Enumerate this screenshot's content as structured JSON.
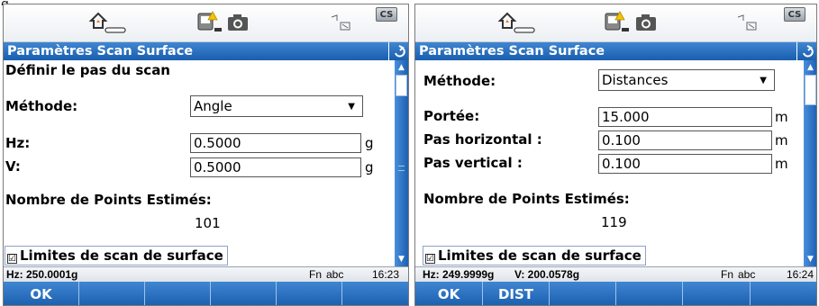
{
  "caption": "g",
  "left": {
    "title": "Paramètres Scan Surface",
    "section_heading": "Définir le pas du scan",
    "method_label": "Méthode:",
    "method_value": "Angle",
    "hz_label": "Hz:",
    "hz_value": "0.5000",
    "hz_unit": "g",
    "v_label": "V:",
    "v_value": "0.5000",
    "v_unit": "g",
    "estimate_label": "Nombre de Points Estimés:",
    "estimate_value": "101",
    "checkbox_label": "Limites de scan de surface",
    "status_hz": "Hz: 250.0001g",
    "status_fn": "Fn",
    "status_abc": "abc",
    "status_time": "16:23",
    "softkeys": [
      "OK",
      "",
      "",
      "",
      "",
      ""
    ]
  },
  "right": {
    "title": "Paramètres Scan Surface",
    "method_label": "Méthode:",
    "method_value": "Distances",
    "range_label": "Portée:",
    "range_value": "15.000",
    "range_unit": "m",
    "hstep_label": "Pas horizontal :",
    "hstep_value": "0.100",
    "hstep_unit": "m",
    "vstep_label": "Pas vertical :",
    "vstep_value": "0.100",
    "vstep_unit": "m",
    "estimate_label": "Nombre de Points Estimés:",
    "estimate_value": "119",
    "checkbox_label": "Limites de scan de surface",
    "status_hz": "Hz: 249.9999g",
    "status_v": "V: 200.0578g",
    "status_fn": "Fn",
    "status_abc": "abc",
    "status_time": "16:24",
    "softkeys": [
      "OK",
      "DIST",
      "",
      "",
      "",
      ""
    ]
  },
  "icons": {
    "cs_badge": "CS",
    "station": "home-station-icon",
    "battery_warning": "battery-warning-icon",
    "camera": "camera-icon",
    "target": "target-prism-icon",
    "back": "back-arrow-icon",
    "checkbox": "☑"
  },
  "colors": {
    "title_blue": "#2a6fc2",
    "status_grey": "#e6e9ee"
  }
}
